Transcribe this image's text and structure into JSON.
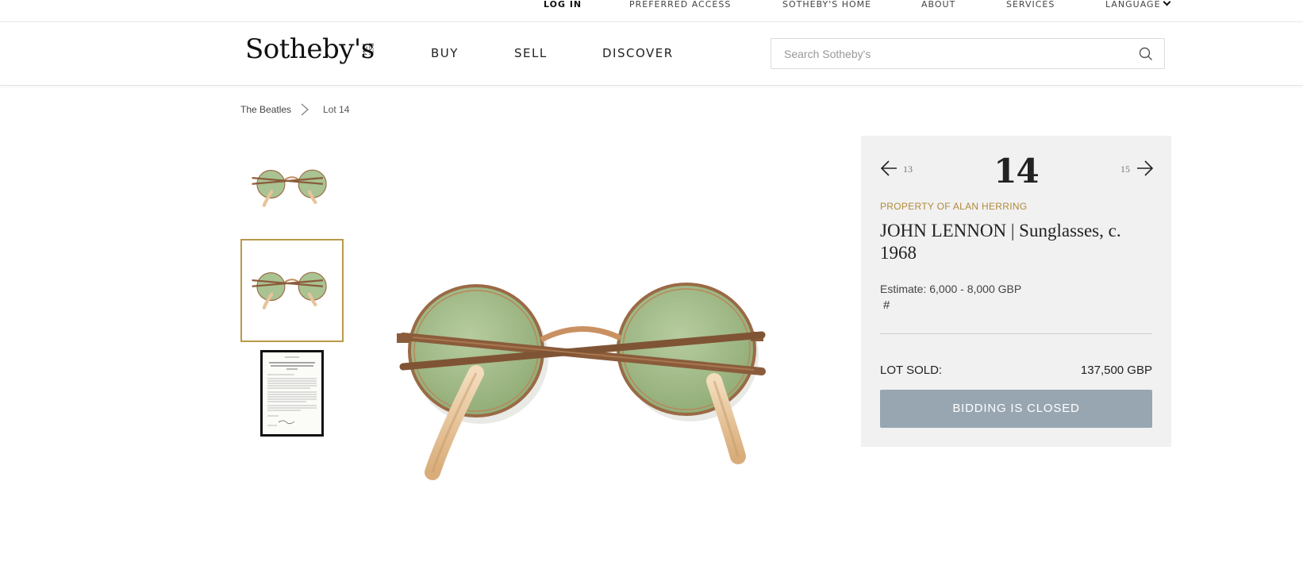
{
  "utility_nav": {
    "login": "LOG IN",
    "preferred_access": "PREFERRED ACCESS",
    "home": "SOTHEBY'S HOME",
    "about": "ABOUT",
    "services": "SERVICES",
    "language": "LANGUAGE"
  },
  "header": {
    "logo": "Sotheby's",
    "logo_est": "EST. 1744",
    "nav": {
      "buy": "BUY",
      "sell": "SELL",
      "discover": "DISCOVER"
    },
    "search": {
      "placeholder": "Search Sotheby's",
      "value": ""
    }
  },
  "breadcrumb": {
    "items": [
      "The Beatles",
      "Lot 14"
    ]
  },
  "thumbnails": [
    {
      "label": "sunglasses-view-1",
      "selected": false
    },
    {
      "label": "sunglasses-view-2",
      "selected": true
    },
    {
      "label": "letter-document",
      "selected": false
    }
  ],
  "lot": {
    "prev": "13",
    "number": "14",
    "next": "15",
    "provenance": "PROPERTY OF ALAN HERRING",
    "title": "JOHN LENNON | Sunglasses, c. 1968",
    "estimate": "Estimate: 6,000 - 8,000 GBP",
    "hash": "#",
    "sold_label": "LOT SOLD:",
    "sold_price": "137,500 GBP",
    "bid_button": "BIDDING IS CLOSED"
  },
  "colors": {
    "accent_gold": "#b18a3a",
    "panel_bg": "#f1f1f1",
    "button_disabled": "#98a6b2",
    "lens_green": "#a9c392",
    "frame_copper": "#9a6a45"
  }
}
